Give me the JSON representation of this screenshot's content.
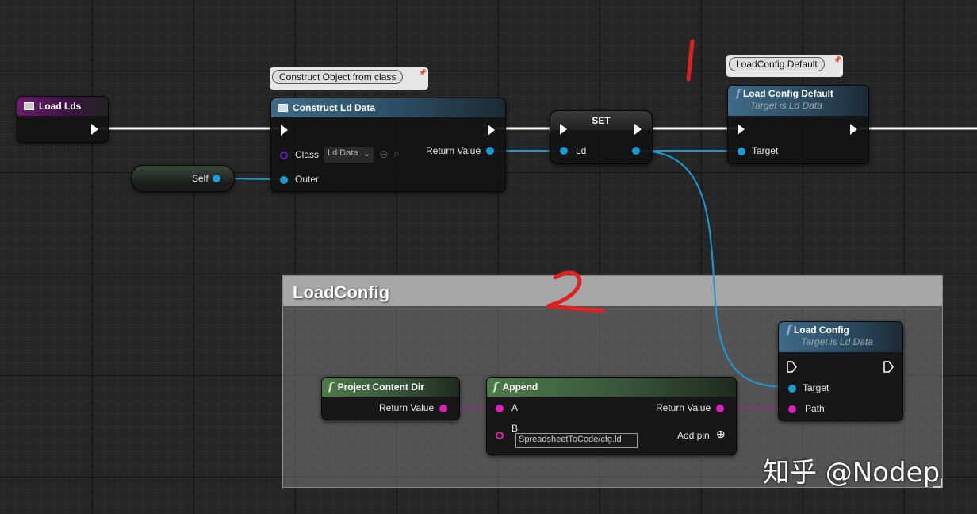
{
  "annotations": {
    "mark1": "1",
    "mark2": "2"
  },
  "comment": {
    "title": "LoadConfig"
  },
  "nodes": {
    "load_lds": {
      "title": "Load Lds"
    },
    "construct": {
      "bubble": "Construct Object from class",
      "title": "Construct Ld Data",
      "class_label": "Class",
      "class_value": "Ld Data",
      "outer_label": "Outer",
      "return_label": "Return Value"
    },
    "self": {
      "label": "Self"
    },
    "set": {
      "title": "SET",
      "ld_label": "Ld"
    },
    "load_config_default": {
      "bubble": "LoadConfig Default",
      "title": "Load Config Default",
      "subtitle": "Target is Ld Data",
      "target_label": "Target"
    },
    "load_config": {
      "title": "Load Config",
      "subtitle": "Target is Ld Data",
      "target_label": "Target",
      "path_label": "Path"
    },
    "project_content_dir": {
      "title": "Project Content Dir",
      "return_label": "Return Value"
    },
    "append": {
      "title": "Append",
      "a_label": "A",
      "b_label": "B",
      "b_value": "SpreadsheetToCode/cfg.ld",
      "return_label": "Return Value",
      "add_pin_label": "Add pin"
    }
  },
  "watermark": "知乎 @Nodep",
  "colors": {
    "exec": "#ffffff",
    "object_pin": "#1a9bd7",
    "string_pin": "#e01fbe",
    "annotation": "#e02020"
  }
}
